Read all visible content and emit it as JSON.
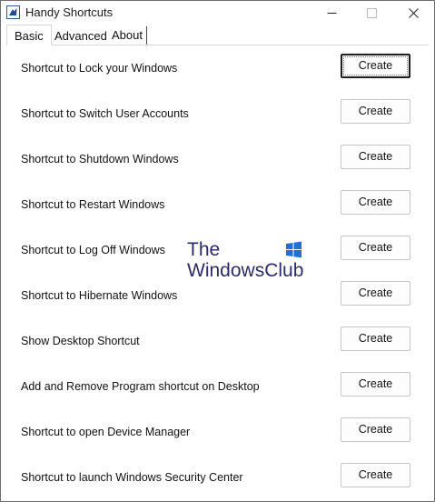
{
  "window": {
    "title": "Handy Shortcuts"
  },
  "tabs": [
    {
      "label": "Basic",
      "active": true
    },
    {
      "label": "Advanced",
      "active": false
    },
    {
      "label": "About",
      "active": false
    }
  ],
  "rows": [
    {
      "label": "Shortcut to Lock your Windows",
      "button": "Create",
      "default": true
    },
    {
      "label": "Shortcut to Switch User Accounts",
      "button": "Create"
    },
    {
      "label": "Shortcut to Shutdown Windows",
      "button": "Create"
    },
    {
      "label": "Shortcut to Restart Windows",
      "button": "Create"
    },
    {
      "label": "Shortcut to Log Off Windows",
      "button": "Create"
    },
    {
      "label": "Shortcut to Hibernate Windows",
      "button": "Create"
    },
    {
      "label": "Show Desktop Shortcut",
      "button": "Create"
    },
    {
      "label": "Add and Remove Program shortcut on Desktop",
      "button": "Create"
    },
    {
      "label": "Shortcut to open Device Manager",
      "button": "Create"
    },
    {
      "label": "Shortcut to launch Windows Security Center",
      "button": "Create"
    }
  ],
  "watermark": {
    "line1": "The",
    "line2": "WindowsClub",
    "logo_icon": "windows-logo-icon"
  },
  "icons": {
    "app": "app-icon",
    "minimize": "minimize-icon",
    "maximize": "maximize-icon",
    "close": "close-icon"
  },
  "colors": {
    "watermark_text": "#2b2b6a",
    "watermark_logo": "#1e6fd9"
  }
}
